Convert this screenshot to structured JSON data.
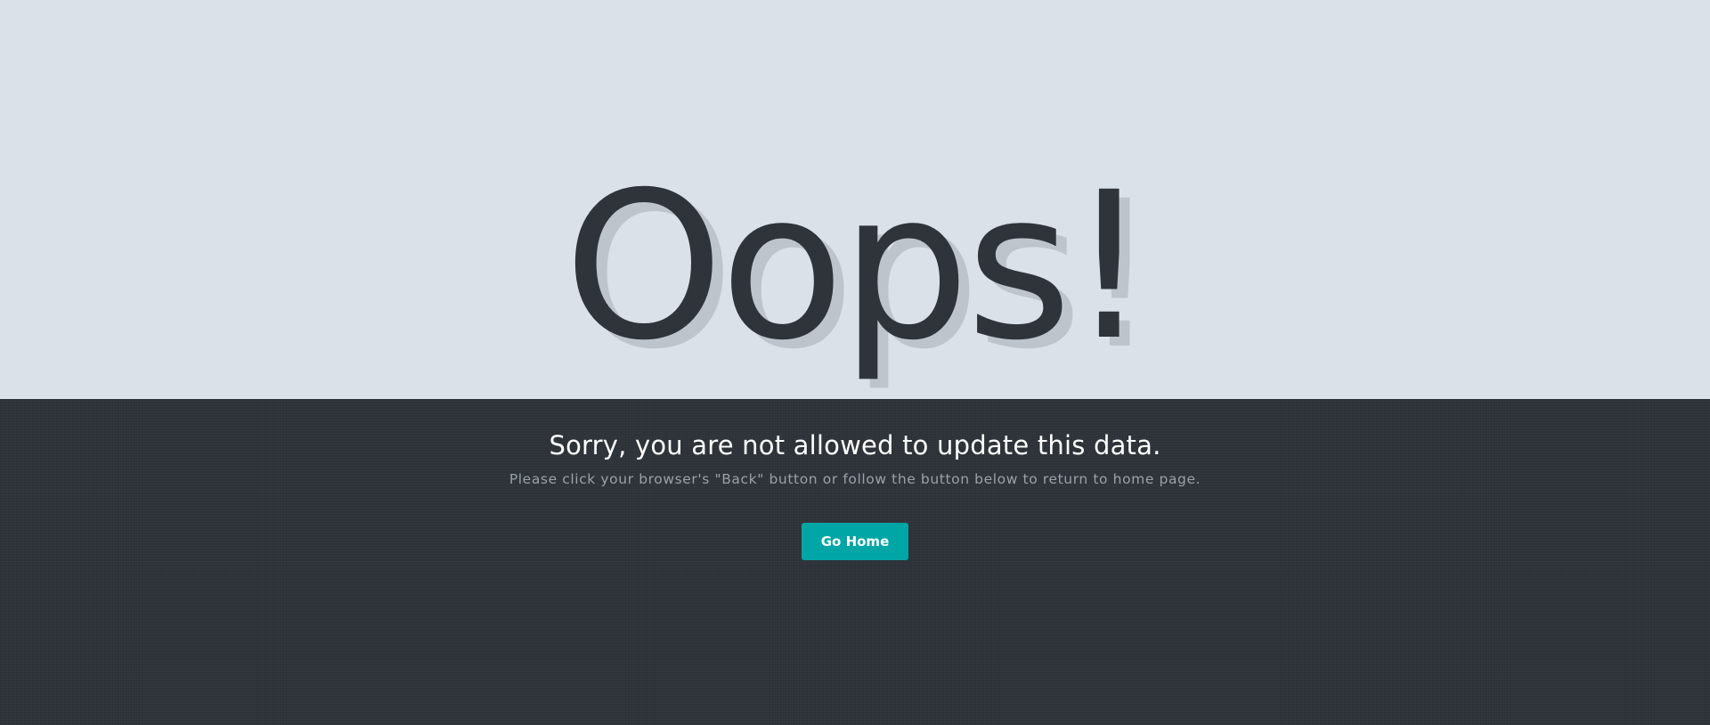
{
  "error": {
    "headline": "Oops!",
    "message": "Sorry, you are not allowed to update this data.",
    "submessage": "Please click your browser's \"Back\" button or follow the button below to return to home page."
  },
  "actions": {
    "go_home_label": "Go Home"
  },
  "colors": {
    "top_background": "#dbe1e8",
    "bottom_background": "#2e3439",
    "headline": "#2e3439",
    "accent_button": "#00a6a6",
    "message_text": "#ffffff",
    "submessage_text": "#9aa1a8"
  }
}
